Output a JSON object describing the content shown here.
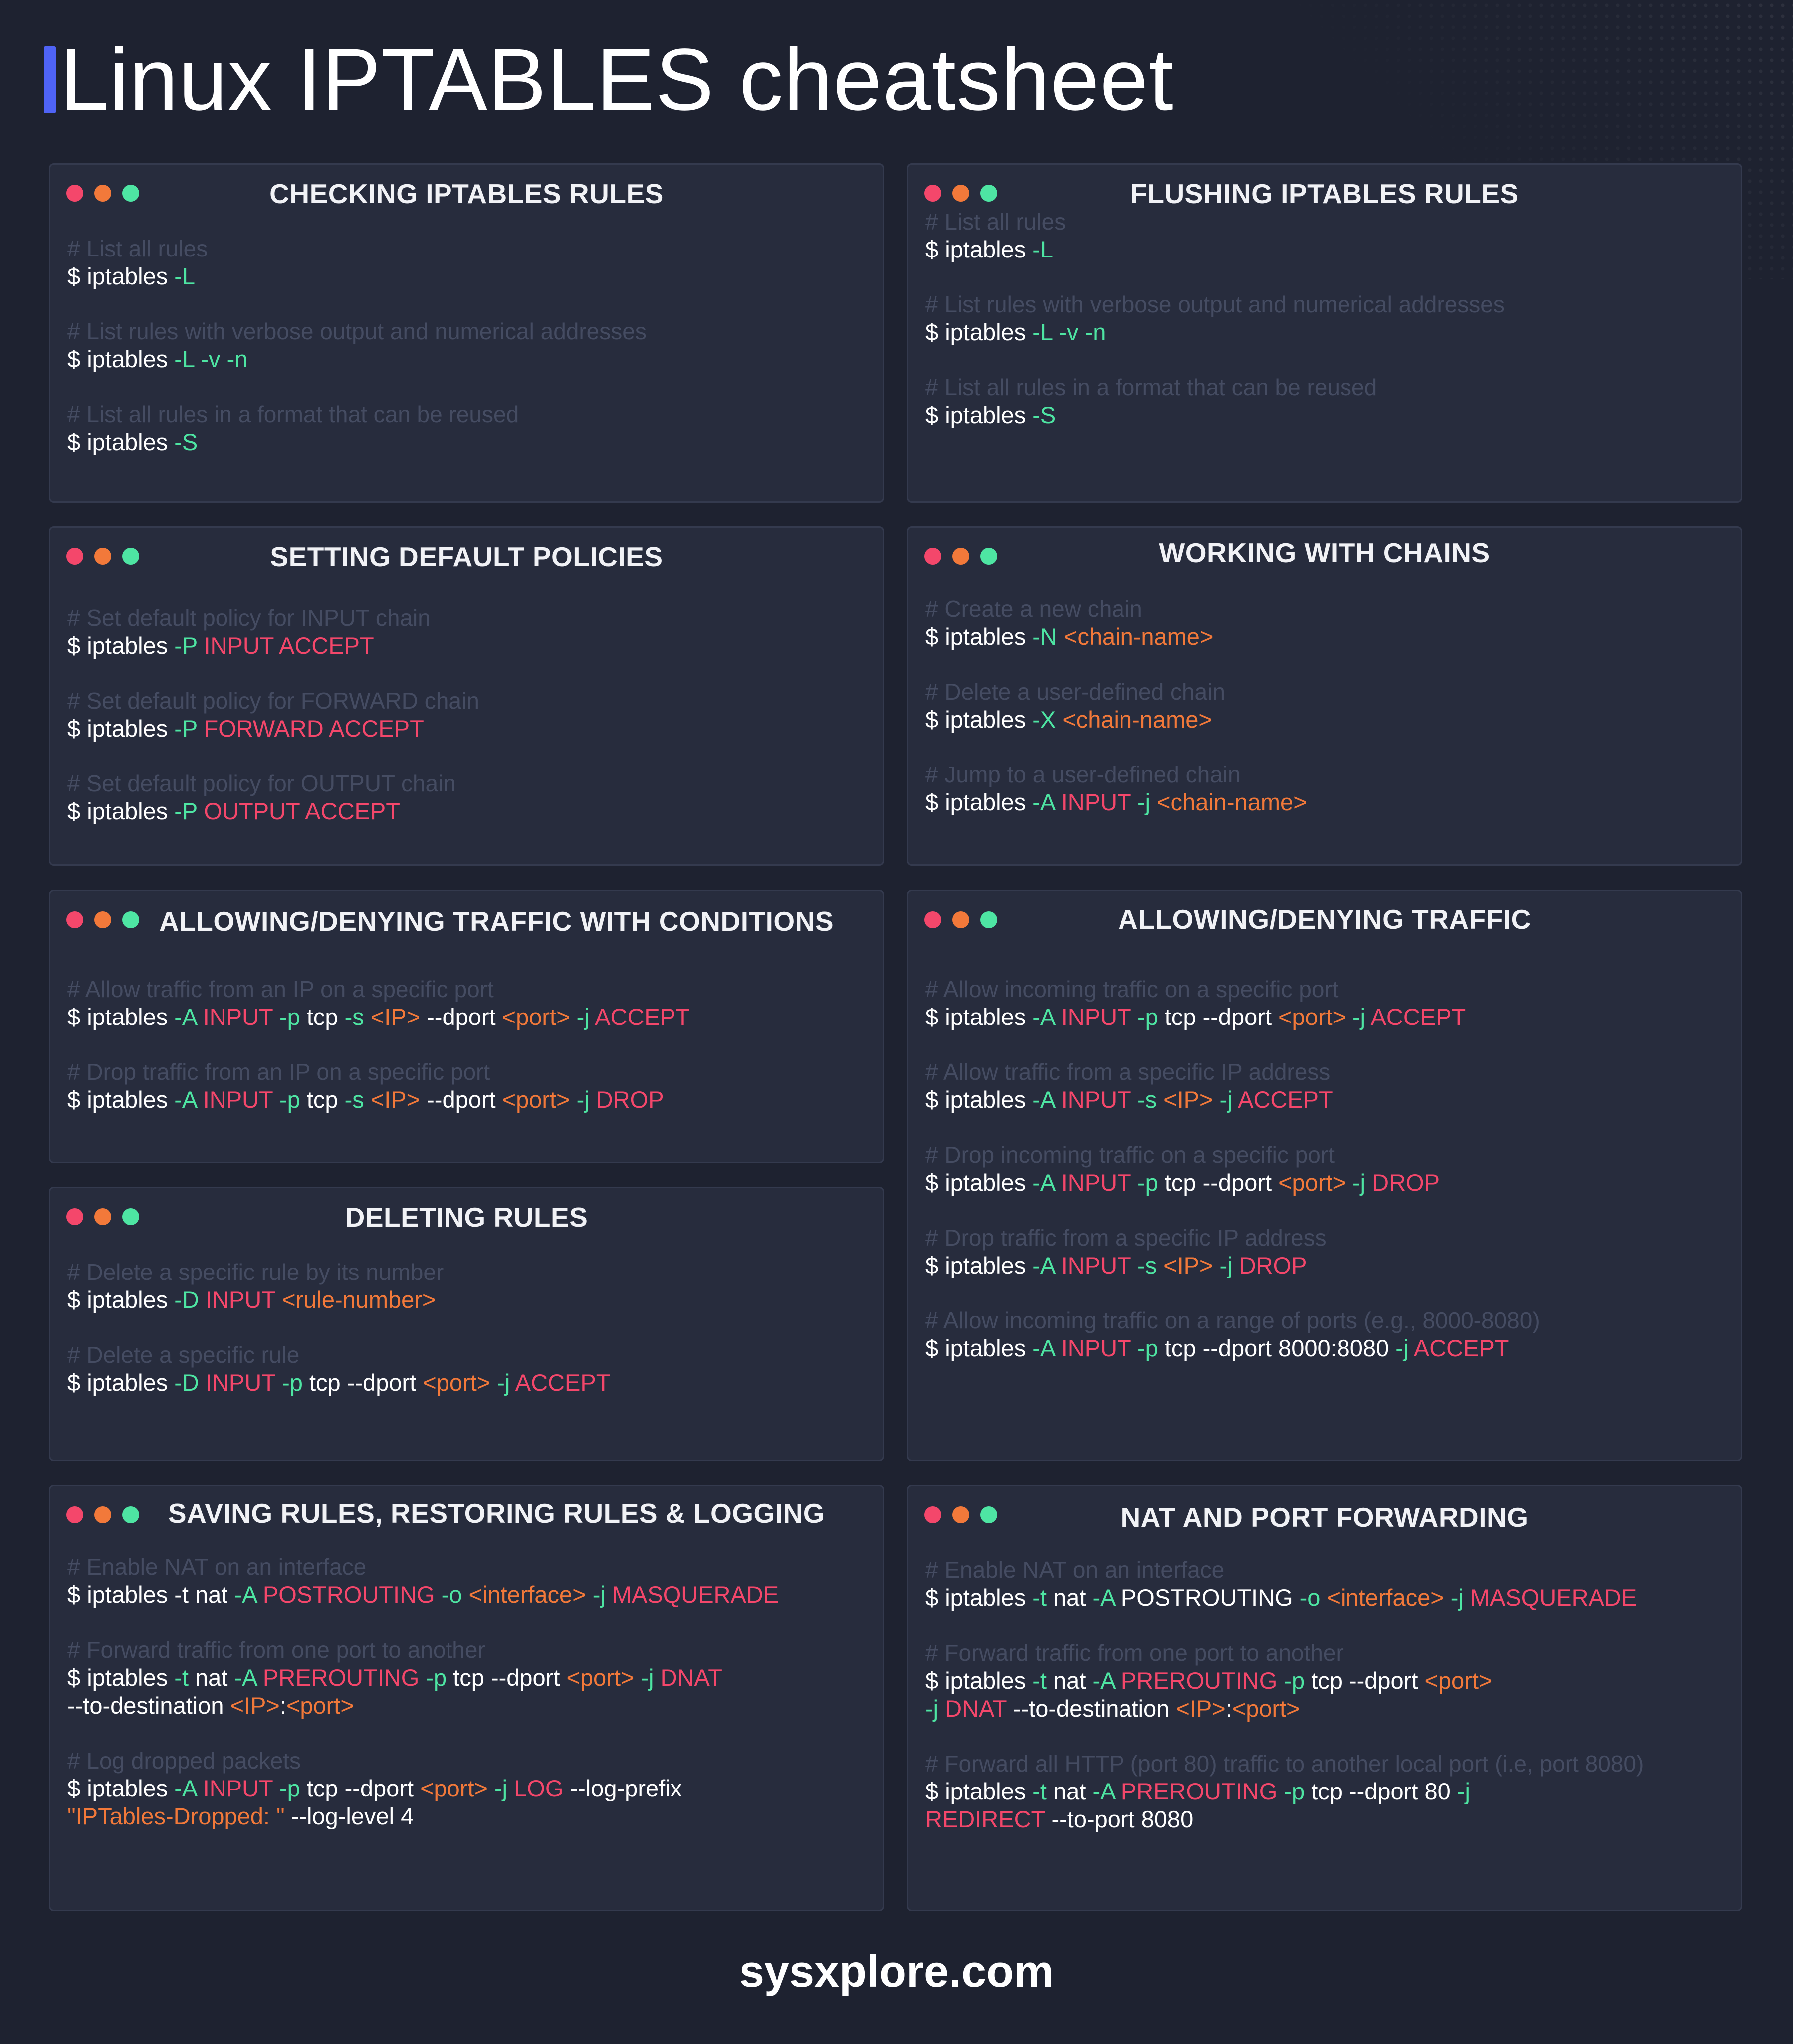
{
  "title": "Linux IPTABLES cheatsheet",
  "footer": "sysxplore.com",
  "colors": {
    "background": "#1e2230",
    "card": "#272c3d",
    "accent_bar": "#4f63f5",
    "option_green": "#4ee5a3",
    "keyword_red": "#f4476b",
    "placeholder_orange": "#f2793a",
    "comment_gray": "#454c62"
  },
  "sections": [
    {
      "title": "CHECKING IPTABLES RULES",
      "entries": [
        {
          "comment": "# List all rules",
          "lines": [
            [
              [
                "w",
                "$ iptables "
              ],
              [
                "g",
                "-L"
              ]
            ]
          ]
        },
        {
          "comment": "# List rules with verbose output and numerical addresses",
          "lines": [
            [
              [
                "w",
                "$ iptables "
              ],
              [
                "g",
                "-L -v -n"
              ]
            ]
          ]
        },
        {
          "comment": "# List all rules in a format that can be reused",
          "lines": [
            [
              [
                "w",
                "$ iptables "
              ],
              [
                "g",
                "-S"
              ]
            ]
          ]
        }
      ]
    },
    {
      "title": "FLUSHING IPTABLES RULES",
      "entries": [
        {
          "comment": "# List all rules",
          "lines": [
            [
              [
                "w",
                "$ iptables "
              ],
              [
                "g",
                "-L"
              ]
            ]
          ]
        },
        {
          "comment": "# List rules with verbose output and numerical addresses",
          "lines": [
            [
              [
                "w",
                "$ iptables "
              ],
              [
                "g",
                "-L -v -n"
              ]
            ]
          ]
        },
        {
          "comment": "# List all rules in a format that can be reused",
          "lines": [
            [
              [
                "w",
                "$ iptables "
              ],
              [
                "g",
                "-S"
              ]
            ]
          ]
        }
      ]
    },
    {
      "title": "SETTING DEFAULT POLICIES",
      "entries": [
        {
          "comment": "# Set default policy for INPUT chain",
          "lines": [
            [
              [
                "w",
                "$ iptables "
              ],
              [
                "g",
                "-P "
              ],
              [
                "r",
                "INPUT ACCEPT"
              ]
            ]
          ]
        },
        {
          "comment": "# Set default policy for FORWARD chain",
          "lines": [
            [
              [
                "w",
                "$ iptables "
              ],
              [
                "g",
                "-P "
              ],
              [
                "r",
                "FORWARD ACCEPT"
              ]
            ]
          ]
        },
        {
          "comment": "# Set default policy for OUTPUT chain",
          "lines": [
            [
              [
                "w",
                "$ iptables "
              ],
              [
                "g",
                "-P "
              ],
              [
                "r",
                "OUTPUT ACCEPT"
              ]
            ]
          ]
        }
      ]
    },
    {
      "title": "WORKING WITH CHAINS",
      "entries": [
        {
          "comment": "# Create a new chain",
          "lines": [
            [
              [
                "w",
                "$ iptables "
              ],
              [
                "g",
                "-N "
              ],
              [
                "o",
                "<chain-name>"
              ]
            ]
          ]
        },
        {
          "comment": "# Delete a user-defined chain",
          "lines": [
            [
              [
                "w",
                "$ iptables "
              ],
              [
                "g",
                "-X "
              ],
              [
                "o",
                "<chain-name>"
              ]
            ]
          ]
        },
        {
          "comment": "# Jump to a user-defined chain",
          "lines": [
            [
              [
                "w",
                "$ iptables "
              ],
              [
                "g",
                "-A "
              ],
              [
                "r",
                "INPUT "
              ],
              [
                "g",
                "-j "
              ],
              [
                "o",
                "<chain-name>"
              ]
            ]
          ]
        }
      ]
    },
    {
      "title": "ALLOWING/DENYING TRAFFIC WITH CONDITIONS",
      "entries": [
        {
          "comment": "# Allow traffic from an IP on a specific port",
          "lines": [
            [
              [
                "w",
                "$ iptables "
              ],
              [
                "g",
                "-A "
              ],
              [
                "r",
                "INPUT "
              ],
              [
                "g",
                "-p "
              ],
              [
                "w",
                "tcp "
              ],
              [
                "g",
                "-s "
              ],
              [
                "o",
                "<IP> "
              ],
              [
                "w",
                "--dport "
              ],
              [
                "o",
                "<port> "
              ],
              [
                "g",
                "-j "
              ],
              [
                "r",
                "ACCEPT"
              ]
            ]
          ]
        },
        {
          "comment": "# Drop traffic from an IP on a specific port",
          "lines": [
            [
              [
                "w",
                "$ iptables "
              ],
              [
                "g",
                "-A "
              ],
              [
                "r",
                "INPUT "
              ],
              [
                "g",
                "-p "
              ],
              [
                "w",
                "tcp "
              ],
              [
                "g",
                "-s "
              ],
              [
                "o",
                "<IP> "
              ],
              [
                "w",
                "--dport "
              ],
              [
                "o",
                "<port> "
              ],
              [
                "g",
                "-j "
              ],
              [
                "r",
                "DROP"
              ]
            ]
          ]
        }
      ]
    },
    {
      "title": "ALLOWING/DENYING TRAFFIC",
      "entries": [
        {
          "comment": "# Allow incoming traffic on a specific port",
          "lines": [
            [
              [
                "w",
                "$ iptables "
              ],
              [
                "g",
                "-A "
              ],
              [
                "r",
                "INPUT "
              ],
              [
                "g",
                "-p "
              ],
              [
                "w",
                "tcp --dport "
              ],
              [
                "o",
                "<port> "
              ],
              [
                "g",
                "-j "
              ],
              [
                "r",
                "ACCEPT"
              ]
            ]
          ]
        },
        {
          "comment": "# Allow traffic from a specific IP address",
          "lines": [
            [
              [
                "w",
                "$ iptables "
              ],
              [
                "g",
                "-A "
              ],
              [
                "r",
                "INPUT "
              ],
              [
                "g",
                "-s "
              ],
              [
                "o",
                "<IP> "
              ],
              [
                "g",
                "-j "
              ],
              [
                "r",
                "ACCEPT"
              ]
            ]
          ]
        },
        {
          "comment": "# Drop incoming traffic on a specific port",
          "lines": [
            [
              [
                "w",
                "$ iptables "
              ],
              [
                "g",
                "-A "
              ],
              [
                "r",
                "INPUT "
              ],
              [
                "g",
                "-p "
              ],
              [
                "w",
                "tcp --dport "
              ],
              [
                "o",
                "<port> "
              ],
              [
                "g",
                "-j "
              ],
              [
                "r",
                "DROP"
              ]
            ]
          ]
        },
        {
          "comment": "# Drop traffic from a specific IP address",
          "lines": [
            [
              [
                "w",
                "$ iptables "
              ],
              [
                "g",
                "-A "
              ],
              [
                "r",
                "INPUT "
              ],
              [
                "g",
                "-s "
              ],
              [
                "o",
                "<IP> "
              ],
              [
                "g",
                "-j "
              ],
              [
                "r",
                "DROP"
              ]
            ]
          ]
        },
        {
          "comment": "# Allow incoming traffic on a range of ports (e.g., 8000-8080)",
          "lines": [
            [
              [
                "w",
                "$ iptables "
              ],
              [
                "g",
                "-A "
              ],
              [
                "r",
                "INPUT "
              ],
              [
                "g",
                "-p "
              ],
              [
                "w",
                "tcp --dport 8000:8080 "
              ],
              [
                "g",
                "-j "
              ],
              [
                "r",
                "ACCEPT"
              ]
            ]
          ]
        }
      ]
    },
    {
      "title": "DELETING RULES",
      "entries": [
        {
          "comment": "# Delete a specific rule by its number",
          "lines": [
            [
              [
                "w",
                "$ iptables "
              ],
              [
                "g",
                "-D "
              ],
              [
                "r",
                "INPUT "
              ],
              [
                "o",
                "<rule-number>"
              ]
            ]
          ]
        },
        {
          "comment": "# Delete a specific rule",
          "lines": [
            [
              [
                "w",
                "$ iptables "
              ],
              [
                "g",
                "-D "
              ],
              [
                "r",
                "INPUT "
              ],
              [
                "g",
                "-p "
              ],
              [
                "w",
                "tcp --dport "
              ],
              [
                "o",
                "<port> "
              ],
              [
                "g",
                "-j "
              ],
              [
                "r",
                "ACCEPT"
              ]
            ]
          ]
        }
      ]
    },
    {
      "title": "SAVING RULES, RESTORING  RULES & LOGGING",
      "entries": [
        {
          "comment": "# Enable NAT on an interface",
          "lines": [
            [
              [
                "w",
                "$ iptables -t nat "
              ],
              [
                "g",
                "-A "
              ],
              [
                "r",
                "POSTROUTING "
              ],
              [
                "g",
                "-o "
              ],
              [
                "o",
                "<interface> "
              ],
              [
                "g",
                "-j "
              ],
              [
                "r",
                "MASQUERADE"
              ]
            ]
          ]
        },
        {
          "comment": "# Forward traffic from one port to another",
          "lines": [
            [
              [
                "w",
                "$ iptables "
              ],
              [
                "g",
                "-t "
              ],
              [
                "w",
                "nat "
              ],
              [
                "g",
                "-A "
              ],
              [
                "r",
                "PREROUTING "
              ],
              [
                "g",
                "-p "
              ],
              [
                "w",
                "tcp --dport "
              ],
              [
                "o",
                "<port> "
              ],
              [
                "g",
                "-j "
              ],
              [
                "r",
                "DNAT"
              ]
            ],
            [
              [
                "w",
                "--to-destination "
              ],
              [
                "o",
                "<IP>"
              ],
              [
                "w",
                ":"
              ],
              [
                "o",
                "<port>"
              ]
            ]
          ]
        },
        {
          "comment": "# Log dropped packets",
          "lines": [
            [
              [
                "w",
                "$ iptables "
              ],
              [
                "g",
                "-A "
              ],
              [
                "r",
                "INPUT "
              ],
              [
                "g",
                "-p "
              ],
              [
                "w",
                "tcp --dport "
              ],
              [
                "o",
                "<port> "
              ],
              [
                "g",
                "-j "
              ],
              [
                "r",
                "LOG "
              ],
              [
                "w",
                "--log-prefix"
              ]
            ],
            [
              [
                "o",
                "\"IPTables-Dropped: \" "
              ],
              [
                "w",
                "--log-level 4"
              ]
            ]
          ]
        }
      ]
    },
    {
      "title": "NAT AND PORT FORWARDING",
      "entries": [
        {
          "comment": "# Enable NAT on an interface",
          "lines": [
            [
              [
                "w",
                "$ iptables "
              ],
              [
                "g",
                "-t "
              ],
              [
                "w",
                "nat "
              ],
              [
                "g",
                "-A "
              ],
              [
                "w",
                "POSTROUTING "
              ],
              [
                "g",
                "-o "
              ],
              [
                "o",
                "<interface> "
              ],
              [
                "g",
                "-j "
              ],
              [
                "r",
                "MASQUERADE"
              ]
            ]
          ]
        },
        {
          "comment": "# Forward traffic from one port to another",
          "lines": [
            [
              [
                "w",
                "$ iptables "
              ],
              [
                "g",
                "-t "
              ],
              [
                "w",
                "nat "
              ],
              [
                "g",
                "-A "
              ],
              [
                "r",
                "PREROUTING "
              ],
              [
                "g",
                "-p "
              ],
              [
                "w",
                "tcp --dport "
              ],
              [
                "o",
                "<port>"
              ]
            ],
            [
              [
                "g",
                "-j "
              ],
              [
                "r",
                "DNAT "
              ],
              [
                "w",
                "--to-destination "
              ],
              [
                "o",
                "<IP>"
              ],
              [
                "w",
                ":"
              ],
              [
                "o",
                "<port>"
              ]
            ]
          ]
        },
        {
          "comment": "# Forward all HTTP (port 80) traffic to another local port (i.e, port 8080)",
          "lines": [
            [
              [
                "w",
                "$ iptables "
              ],
              [
                "g",
                "-t "
              ],
              [
                "w",
                "nat "
              ],
              [
                "g",
                "-A "
              ],
              [
                "r",
                "PREROUTING "
              ],
              [
                "g",
                "-p "
              ],
              [
                "w",
                "tcp --dport 80 "
              ],
              [
                "g",
                "-j"
              ]
            ],
            [
              [
                "r",
                "REDIRECT "
              ],
              [
                "w",
                "--to-port 8080"
              ]
            ]
          ]
        }
      ]
    }
  ]
}
